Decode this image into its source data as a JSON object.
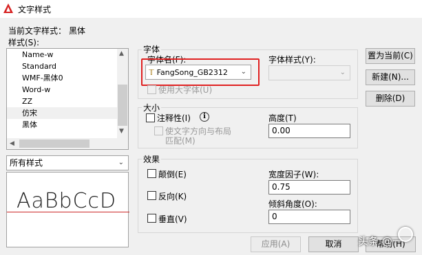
{
  "window": {
    "title": "文字样式"
  },
  "current_style": {
    "label": "当前文字样式：",
    "value": "黑体"
  },
  "styles": {
    "label": "样式(S):",
    "items": [
      "Name-w",
      "Standard",
      "WMF-黑体0",
      "Word-w",
      "ZZ",
      "仿宋",
      "黑体"
    ],
    "selected": "仿宋"
  },
  "filter": {
    "value": "所有样式"
  },
  "preview": {
    "text": "AaBbCcD"
  },
  "font": {
    "group_label": "字体",
    "name_label": "字体名(F):",
    "name_value": "FangSong_GB2312",
    "style_label": "字体样式(Y):",
    "style_value": "",
    "bigfont_label": "使用大字体(U)"
  },
  "size": {
    "group_label": "大小",
    "annotative_label": "注释性(I)",
    "match_orientation_label_1": "使文字方向与布局",
    "match_orientation_label_2": "匹配(M)",
    "height_label": "高度(T)",
    "height_value": "0.00"
  },
  "effects": {
    "group_label": "效果",
    "upside_down_label": "颠倒(E)",
    "backwards_label": "反向(K)",
    "vertical_label": "垂直(V)",
    "width_factor_label": "宽度因子(W):",
    "width_factor_value": "0.75",
    "oblique_label": "倾斜角度(O):",
    "oblique_value": "0"
  },
  "buttons": {
    "set_current": "置为当前(C)",
    "new": "新建(N)...",
    "delete": "删除(D)",
    "apply": "应用(A)",
    "cancel": "取消",
    "help": "帮助(H)"
  },
  "watermark": {
    "text": "头条 @一"
  },
  "colors": {
    "highlight_box": "#e02020",
    "preview_baseline": "#cc2222",
    "app_icon": "#d62020"
  }
}
